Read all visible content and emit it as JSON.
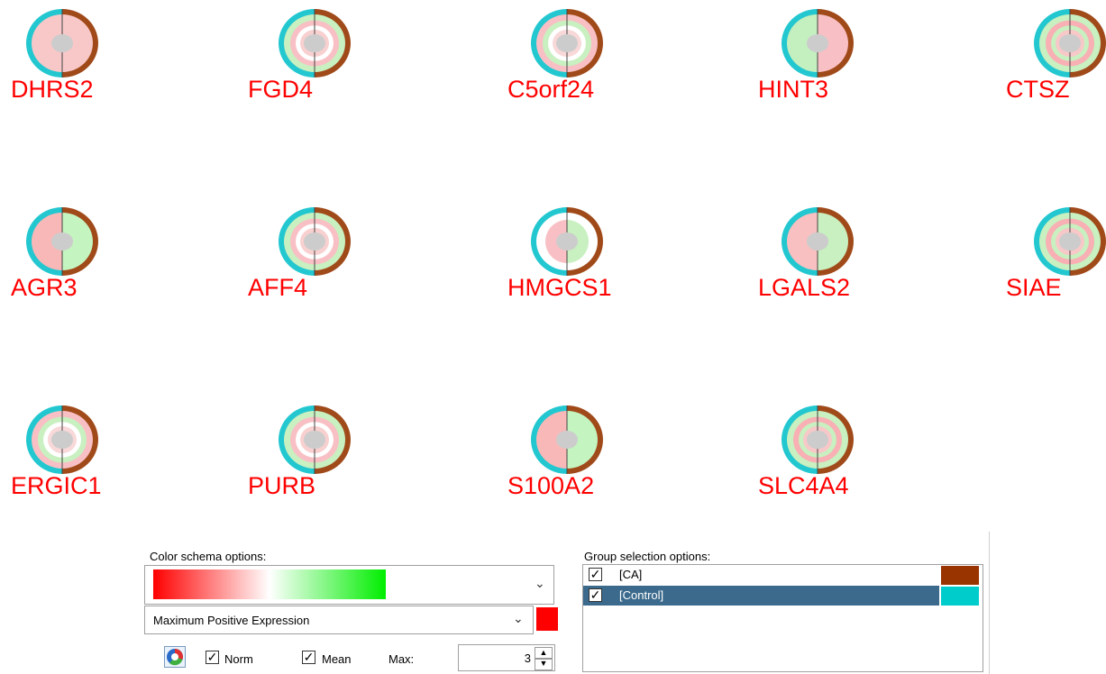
{
  "genes": [
    {
      "name": "DHRS2",
      "pattern": "halves",
      "left": "#f8c8c8",
      "right": "#f8c8c8"
    },
    {
      "name": "FGD4",
      "pattern": "rings"
    },
    {
      "name": "C5orf24",
      "pattern": "rings2"
    },
    {
      "name": "HINT3",
      "pattern": "halves",
      "left": "#c4f0c0",
      "right": "#f8c0c4"
    },
    {
      "name": "CTSZ",
      "pattern": "rings3"
    },
    {
      "name": "AGR3",
      "pattern": "halves",
      "left": "#f8b8b8",
      "right": "#c4f4c0"
    },
    {
      "name": "AFF4",
      "pattern": "rings"
    },
    {
      "name": "HMGCS1",
      "pattern": "hm"
    },
    {
      "name": "LGALS2",
      "pattern": "halves",
      "left": "#f8c0c0",
      "right": "#c8f0c0"
    },
    {
      "name": "SIAE",
      "pattern": "rings3"
    },
    {
      "name": "ERGIC1",
      "pattern": "rings2"
    },
    {
      "name": "PURB",
      "pattern": "rings"
    },
    {
      "name": "S100A2",
      "pattern": "halves",
      "left": "#f8b8b8",
      "right": "#c4f4c0"
    },
    {
      "name": "SLC4A4",
      "pattern": "rings3"
    }
  ],
  "ring_colors": {
    "left": "#22c7d0",
    "right": "#a04a1a",
    "center": "#cccccc"
  },
  "color_panel": {
    "title": "Color schema options:",
    "gradient_low": "#ff0000",
    "gradient_mid": "#ffffff",
    "gradient_high": "#00ee00",
    "mode": "Maximum Positive Expression",
    "mode_swatch": "#ff0000",
    "norm_label": "Norm",
    "mean_label": "Mean",
    "max_label": "Max:",
    "max_value": "3"
  },
  "group_panel": {
    "title": "Group selection options:",
    "groups": [
      {
        "label": "[CA]",
        "color": "#993300",
        "selected": false
      },
      {
        "label": "[Control]",
        "color": "#00cccc",
        "selected": true
      }
    ]
  }
}
